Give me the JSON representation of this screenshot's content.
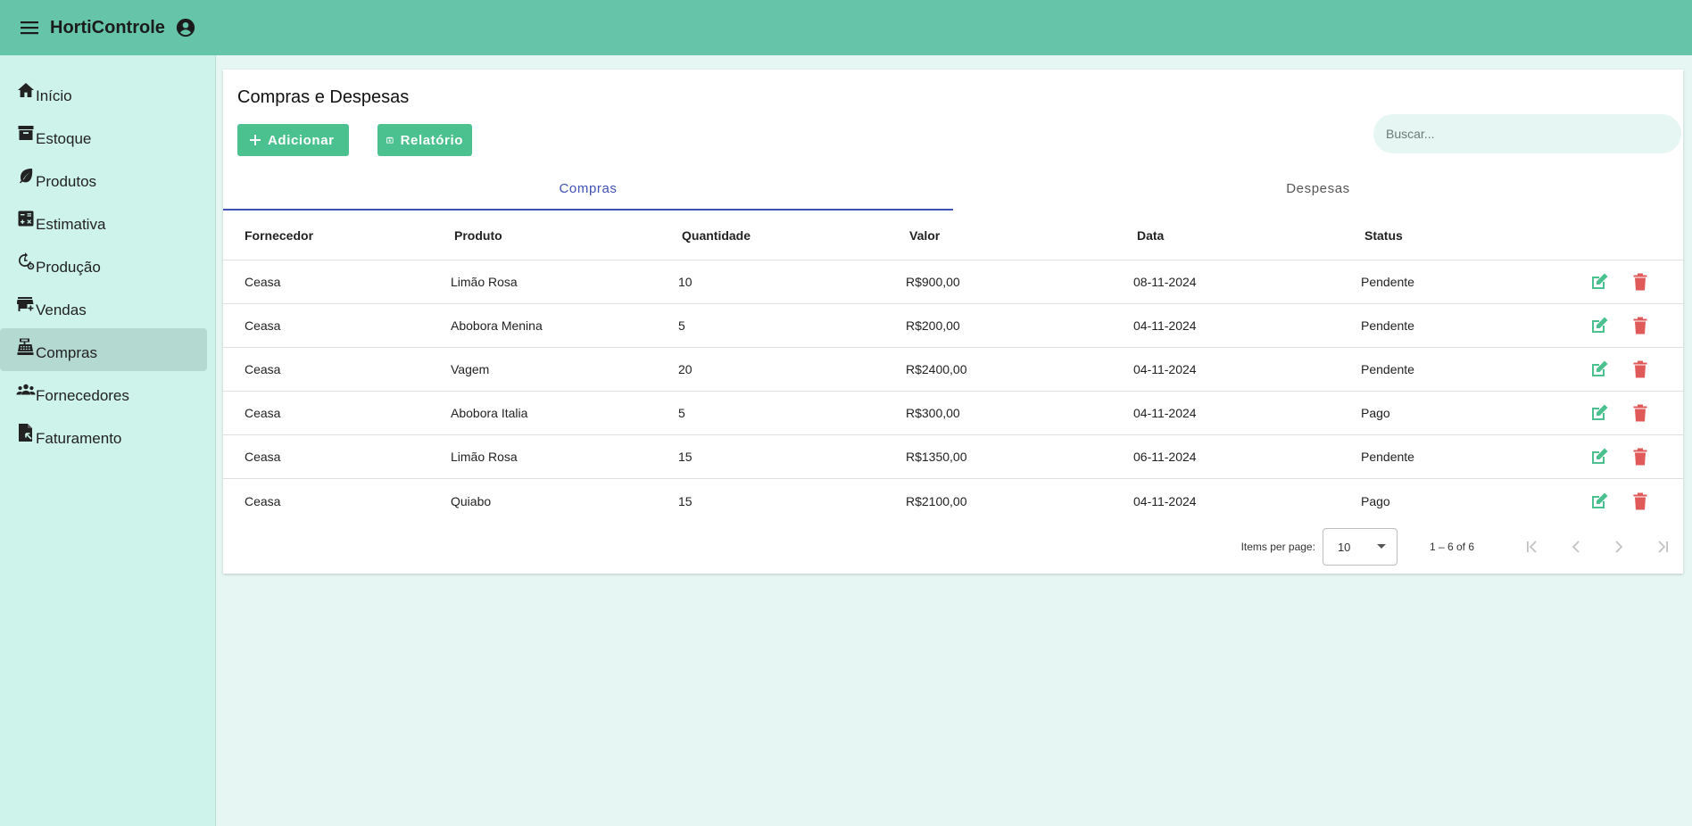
{
  "app": {
    "title": "HortiControle"
  },
  "sidebar": {
    "items": [
      {
        "label": "Início",
        "icon": "home-icon"
      },
      {
        "label": "Estoque",
        "icon": "archive-icon"
      },
      {
        "label": "Produtos",
        "icon": "leaf-icon"
      },
      {
        "label": "Estimativa",
        "icon": "calculator-icon"
      },
      {
        "label": "Produção",
        "icon": "history-settings-icon"
      },
      {
        "label": "Vendas",
        "icon": "store-icon"
      },
      {
        "label": "Compras",
        "icon": "cash-register-icon",
        "active": true
      },
      {
        "label": "Fornecedores",
        "icon": "groups-icon"
      },
      {
        "label": "Faturamento",
        "icon": "invoice-icon"
      }
    ]
  },
  "main": {
    "title": "Compras e Despesas",
    "add_button": "Adicionar",
    "report_button": "Relatório",
    "search_placeholder": "Buscar...",
    "tabs": [
      {
        "label": "Compras",
        "active": true
      },
      {
        "label": "Despesas",
        "active": false
      }
    ],
    "table": {
      "headers": [
        "Fornecedor",
        "Produto",
        "Quantidade",
        "Valor",
        "Data",
        "Status"
      ],
      "rows": [
        [
          "Ceasa",
          "Limão Rosa",
          "10",
          "R$900,00",
          "08-11-2024",
          "Pendente"
        ],
        [
          "Ceasa",
          "Abobora Menina",
          "5",
          "R$200,00",
          "04-11-2024",
          "Pendente"
        ],
        [
          "Ceasa",
          "Vagem",
          "20",
          "R$2400,00",
          "04-11-2024",
          "Pendente"
        ],
        [
          "Ceasa",
          "Abobora Italia",
          "5",
          "R$300,00",
          "04-11-2024",
          "Pago"
        ],
        [
          "Ceasa",
          "Limão Rosa",
          "15",
          "R$1350,00",
          "06-11-2024",
          "Pendente"
        ],
        [
          "Ceasa",
          "Quiabo",
          "15",
          "R$2100,00",
          "04-11-2024",
          "Pago"
        ]
      ]
    },
    "paginator": {
      "items_per_page_label": "Items per page:",
      "items_per_page_value": "10",
      "range": "1 – 6 of 6"
    }
  },
  "colors": {
    "topbar": "#66c5a9",
    "sidebar": "#cdf3ea",
    "background": "#e6f6f2",
    "button": "#4cc190",
    "tab_active": "#3f51b5",
    "edit_icon": "#4cc190",
    "delete_icon": "#e05a5a"
  }
}
